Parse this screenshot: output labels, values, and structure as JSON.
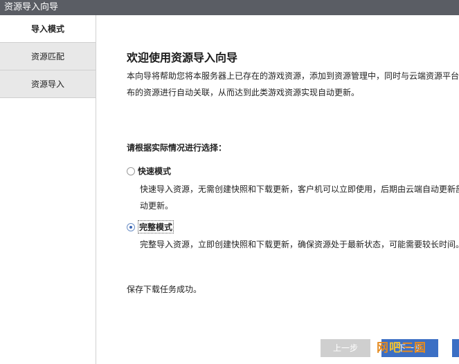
{
  "window": {
    "title": "资源导入向导"
  },
  "sidebar": {
    "items": [
      {
        "label": "导入模式",
        "active": true
      },
      {
        "label": "资源匹配",
        "active": false
      },
      {
        "label": "资源导入",
        "active": false
      }
    ]
  },
  "main": {
    "heading": "欢迎使用资源导入向导",
    "intro_line1": "本向导将帮助您将本服务器上已存在的游戏资源，添加到资源管理中，同时与云端资源平台",
    "intro_line2": "布的资源进行自动关联，从而达到此类游戏资源实现自动更新。",
    "choose_label": "请根据实际情况进行选择：",
    "options": [
      {
        "label": "快速模式",
        "checked": false,
        "desc_line1": "快速导入资源，无需创建快照和下载更新，客户机可以立即使用，后期由云端自动更新部",
        "desc_line2": "动更新。"
      },
      {
        "label": "完整模式",
        "checked": true,
        "desc_line1": "完整导入资源，立即创建快照和下载更新，确保资源处于最新状态，可能需要较长时间。"
      }
    ],
    "status": "保存下载任务成功。"
  },
  "buttons": {
    "prev": "上一步",
    "next": "下一步"
  },
  "watermark": {
    "part1": "网",
    "part2": "吧",
    "part3": "三国"
  },
  "colors": {
    "titlebar": "#5a5d64",
    "accent": "#3c6fc4",
    "disabled_button": "#cfcfcf"
  }
}
